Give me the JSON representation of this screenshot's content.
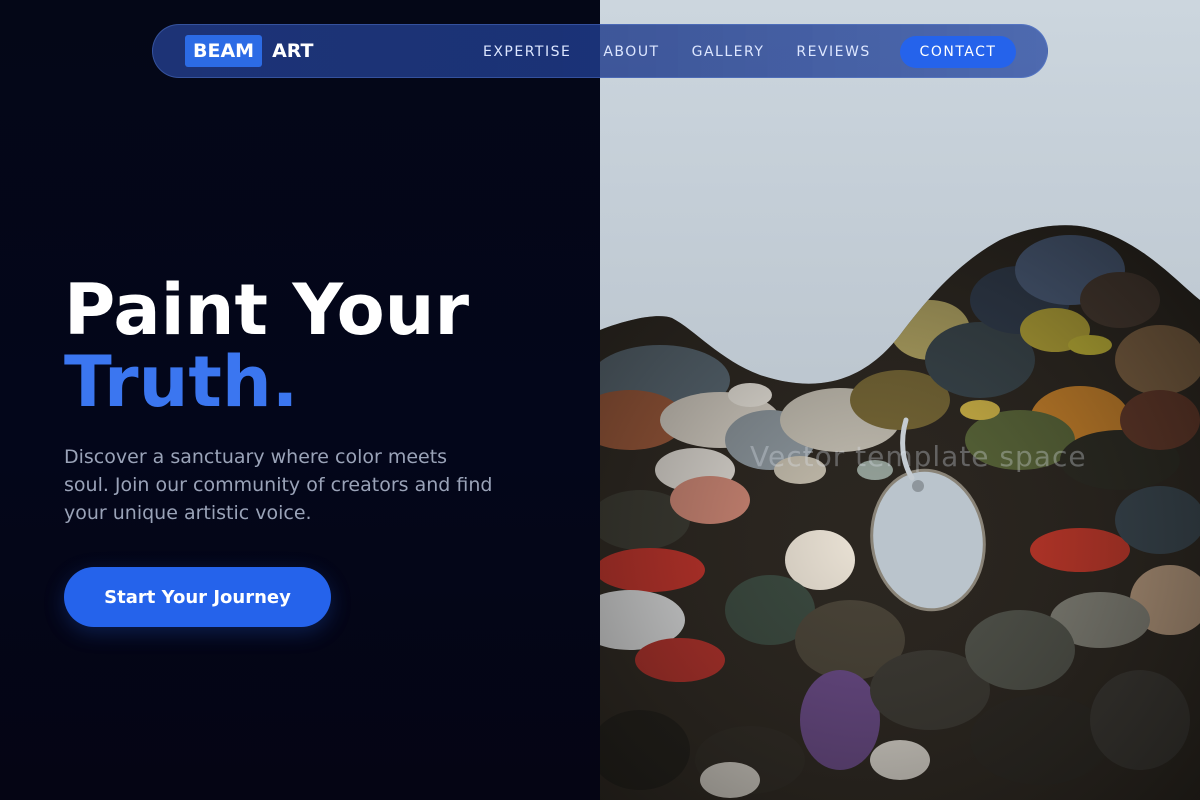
{
  "brand": {
    "logo_box": "BEAM",
    "logo_text": "ART"
  },
  "nav": {
    "links": [
      "EXPERTISE",
      "ABOUT",
      "GALLERY",
      "REVIEWS"
    ],
    "contact": "CONTACT"
  },
  "hero": {
    "title_line1": "Paint Your",
    "title_line2": "Truth.",
    "description": "Discover a sanctuary where color meets soul. Join our community of creators and find your unique artistic voice.",
    "cta": "Start Your Journey"
  },
  "image": {
    "subject": "paint-palette-photo",
    "overlay_text": "Vector template space"
  },
  "colors": {
    "accent": "#2563eb",
    "title_accent": "#3b76f0",
    "background": "#030616",
    "nav_bg": "#213a84"
  }
}
